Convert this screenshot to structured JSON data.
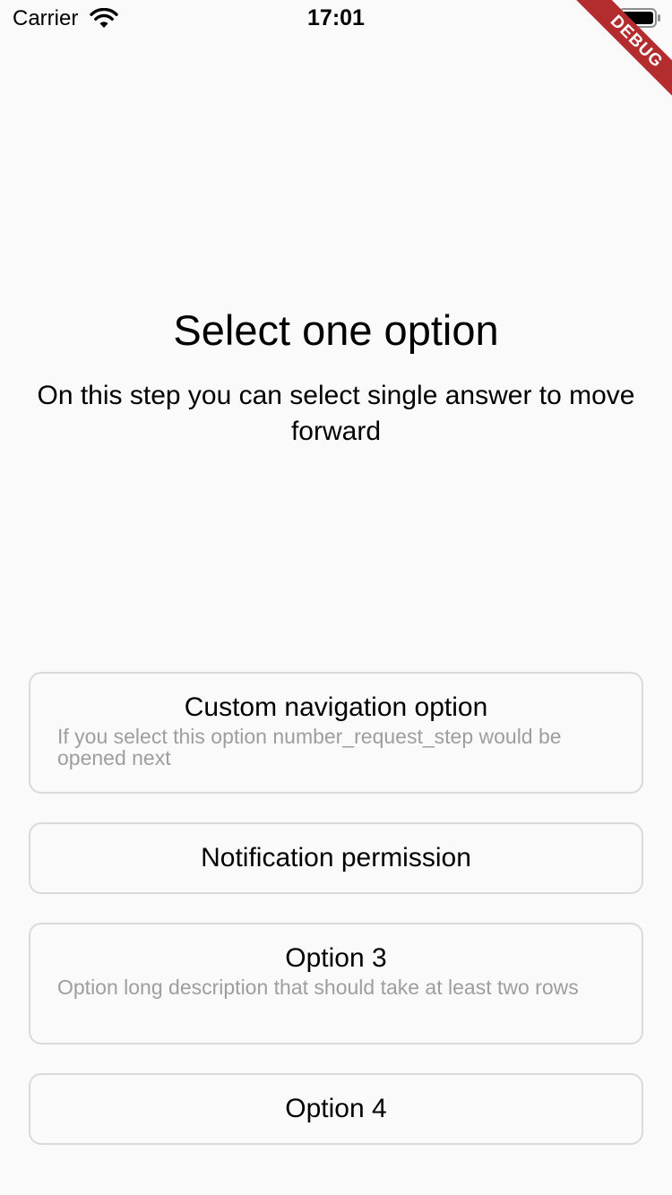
{
  "status_bar": {
    "carrier": "Carrier",
    "time": "17:01",
    "wifi_icon": "wifi-icon",
    "battery_icon": "battery-icon"
  },
  "debug_banner": "DEBUG",
  "header": {
    "title": "Select one option",
    "subtitle": "On this step you can select single answer to move forward"
  },
  "options": [
    {
      "label": "Custom navigation option",
      "description": "If you select this option number_request_step would be opened next"
    },
    {
      "label": "Notification permission"
    },
    {
      "label": "Option 3",
      "description": "Option long description that should take at least two rows"
    },
    {
      "label": "Option 4"
    }
  ],
  "colors": {
    "background": "#fafafa",
    "border": "#dadada",
    "description": "#9e9e9e",
    "debug_banner": "#b32d2e"
  }
}
